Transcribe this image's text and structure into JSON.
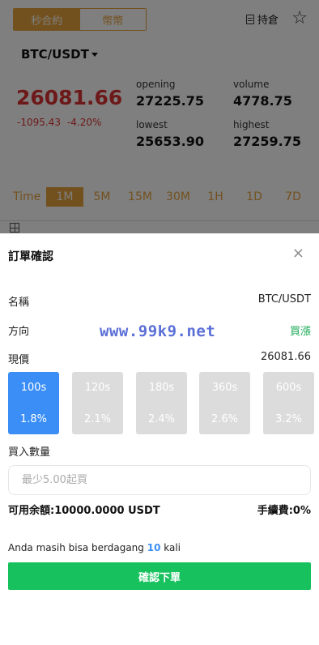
{
  "header": {
    "segment_tabs": [
      "秒合約",
      "幣幣"
    ],
    "position_label": "持倉",
    "pair": "BTC/USDT"
  },
  "ticker": {
    "price": "26081.66",
    "change_abs": "-1095.43",
    "change_pct": "-4.20%",
    "opening_label": "opening",
    "opening": "27225.75",
    "volume_label": "volume",
    "volume": "4778.75",
    "lowest_label": "lowest",
    "lowest": "25653.90",
    "highest_label": "highest",
    "highest": "27259.75"
  },
  "timeframes": [
    "Time",
    "1M",
    "5M",
    "15M",
    "30M",
    "1H",
    "1D",
    "7D"
  ],
  "dialog": {
    "title": "訂單確認",
    "close": "×",
    "name_label": "名稱",
    "name_value": "BTC/USDT",
    "direction_label": "方向",
    "direction_value": "買漲",
    "price_label": "現價",
    "price_value": "26081.66",
    "watermark": "www.99k9.net",
    "options": [
      {
        "secs": "100s",
        "pct": "1.8%"
      },
      {
        "secs": "120s",
        "pct": "2.1%"
      },
      {
        "secs": "180s",
        "pct": "2.4%"
      },
      {
        "secs": "360s",
        "pct": "2.6%"
      },
      {
        "secs": "600s",
        "pct": "3.2%"
      }
    ],
    "qty_label": "買入數量",
    "qty_placeholder": "最少5.00起買",
    "balance": "可用余額:10000.0000 USDT",
    "fee": "手續費:0%",
    "trade_prefix": "Anda masih bisa berdagang ",
    "trade_count": "10",
    "trade_suffix": " kali",
    "confirm_label": "確認下單"
  },
  "colors": {
    "accent": "#e6a23c",
    "down": "#dd3333",
    "up": "#1aaa55",
    "selected": "#3a8ef6",
    "confirm": "#17c25e"
  }
}
